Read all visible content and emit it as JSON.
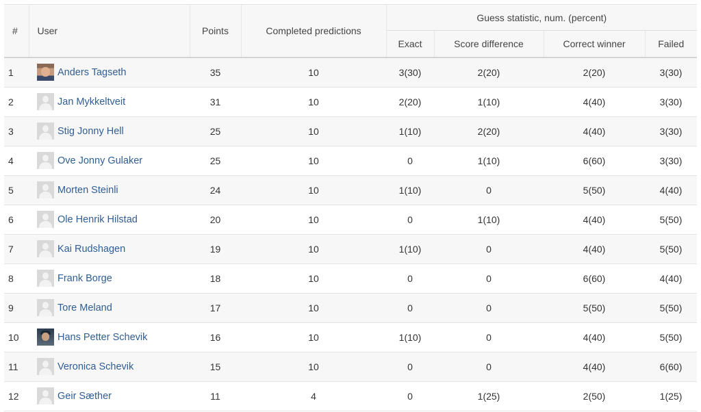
{
  "headers": {
    "rank": "#",
    "user": "User",
    "points": "Points",
    "completed": "Completed predictions",
    "group": "Guess statistic, num. (percent)",
    "exact": "Exact",
    "score_diff": "Score difference",
    "correct_winner": "Correct winner",
    "failed": "Failed"
  },
  "rows": [
    {
      "rank": "1",
      "name": "Anders Tagseth",
      "avatar": "photo-1",
      "points": "35",
      "completed": "10",
      "exact": "3(30)",
      "score_diff": "2(20)",
      "correct_winner": "2(20)",
      "failed": "3(30)"
    },
    {
      "rank": "2",
      "name": "Jan Mykkeltveit",
      "avatar": "default",
      "points": "31",
      "completed": "10",
      "exact": "2(20)",
      "score_diff": "1(10)",
      "correct_winner": "4(40)",
      "failed": "3(30)"
    },
    {
      "rank": "3",
      "name": "Stig Jonny Hell",
      "avatar": "default",
      "points": "25",
      "completed": "10",
      "exact": "1(10)",
      "score_diff": "2(20)",
      "correct_winner": "4(40)",
      "failed": "3(30)"
    },
    {
      "rank": "4",
      "name": "Ove Jonny Gulaker",
      "avatar": "default",
      "points": "25",
      "completed": "10",
      "exact": "0",
      "score_diff": "1(10)",
      "correct_winner": "6(60)",
      "failed": "3(30)"
    },
    {
      "rank": "5",
      "name": "Morten Steinli",
      "avatar": "default",
      "points": "24",
      "completed": "10",
      "exact": "1(10)",
      "score_diff": "0",
      "correct_winner": "5(50)",
      "failed": "4(40)"
    },
    {
      "rank": "6",
      "name": "Ole Henrik Hilstad",
      "avatar": "default",
      "points": "20",
      "completed": "10",
      "exact": "0",
      "score_diff": "1(10)",
      "correct_winner": "4(40)",
      "failed": "5(50)"
    },
    {
      "rank": "7",
      "name": "Kai Rudshagen",
      "avatar": "default",
      "points": "19",
      "completed": "10",
      "exact": "1(10)",
      "score_diff": "0",
      "correct_winner": "4(40)",
      "failed": "5(50)"
    },
    {
      "rank": "8",
      "name": "Frank Borge",
      "avatar": "default",
      "points": "18",
      "completed": "10",
      "exact": "0",
      "score_diff": "0",
      "correct_winner": "6(60)",
      "failed": "4(40)"
    },
    {
      "rank": "9",
      "name": "Tore Meland",
      "avatar": "default",
      "points": "17",
      "completed": "10",
      "exact": "0",
      "score_diff": "0",
      "correct_winner": "5(50)",
      "failed": "5(50)"
    },
    {
      "rank": "10",
      "name": "Hans Petter Schevik",
      "avatar": "photo-2",
      "points": "16",
      "completed": "10",
      "exact": "1(10)",
      "score_diff": "0",
      "correct_winner": "4(40)",
      "failed": "5(50)"
    },
    {
      "rank": "11",
      "name": "Veronica Schevik",
      "avatar": "default",
      "points": "15",
      "completed": "10",
      "exact": "0",
      "score_diff": "0",
      "correct_winner": "4(40)",
      "failed": "6(60)"
    },
    {
      "rank": "12",
      "name": "Geir Sæther",
      "avatar": "default",
      "points": "11",
      "completed": "4",
      "exact": "0",
      "score_diff": "1(25)",
      "correct_winner": "2(50)",
      "failed": "1(25)"
    }
  ]
}
